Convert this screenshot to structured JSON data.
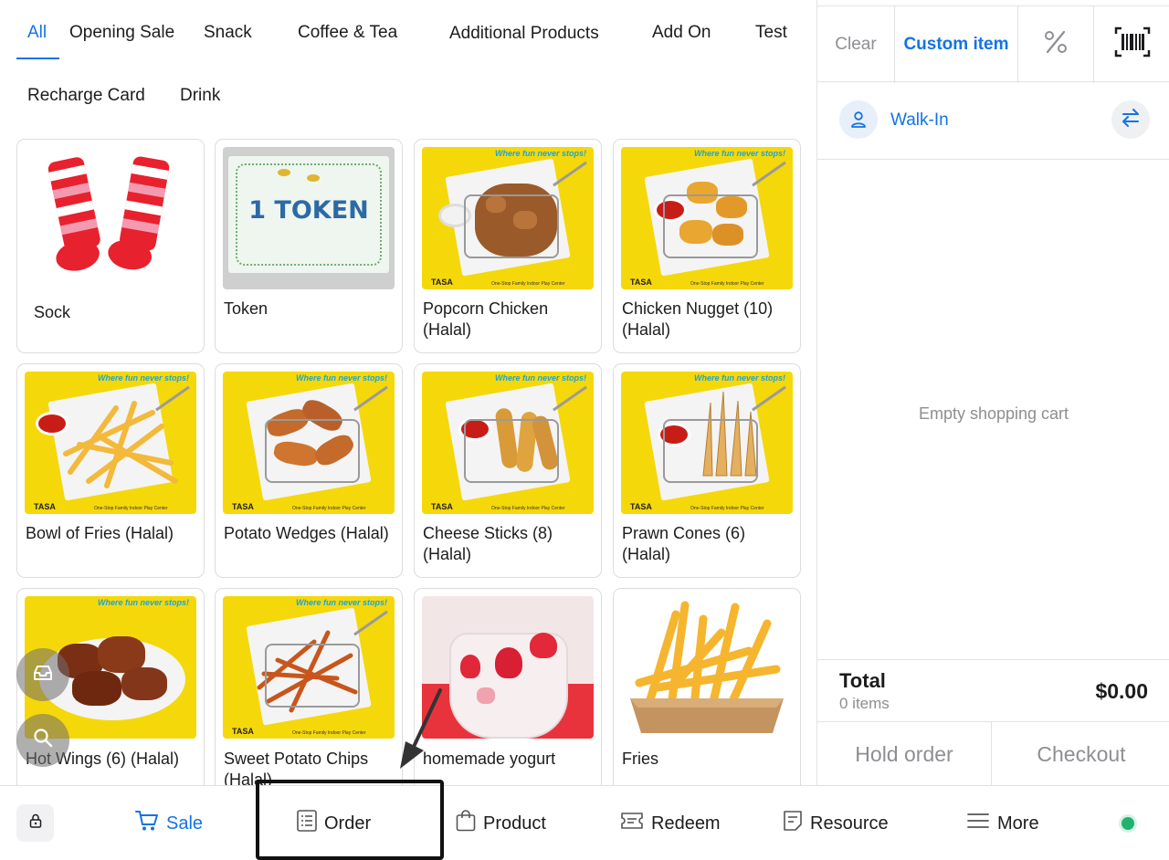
{
  "tabs": [
    {
      "label": "All",
      "active": true
    },
    {
      "label": "Opening Sale"
    },
    {
      "label": "Snack"
    },
    {
      "label": "Coffee & Tea"
    },
    {
      "label": "Additional Products"
    },
    {
      "label": "Add On"
    },
    {
      "label": "Test"
    },
    {
      "label": "Recharge Card"
    },
    {
      "label": "Drink"
    }
  ],
  "products": [
    {
      "name": "Sock",
      "image": "sock"
    },
    {
      "name": "Token",
      "image": "token",
      "image_text": "1 TOKEN"
    },
    {
      "name": "Popcorn Chicken (Halal)",
      "image": "popcorn-chicken"
    },
    {
      "name": "Chicken Nugget (10) (Halal)",
      "image": "chicken-nugget"
    },
    {
      "name": "Bowl of Fries (Halal)",
      "image": "fries-basket"
    },
    {
      "name": "Potato Wedges (Halal)",
      "image": "potato-wedges"
    },
    {
      "name": "Cheese Sticks (8) (Halal)",
      "image": "cheese-sticks"
    },
    {
      "name": "Prawn Cones (6) (Halal)",
      "image": "prawn-cones"
    },
    {
      "name": "Hot Wings (6) (Halal)",
      "image": "hot-wings"
    },
    {
      "name": "Sweet Potato Chips (Halal)",
      "image": "sweet-potato-chips"
    },
    {
      "name": "homemade yogurt",
      "image": "yogurt"
    },
    {
      "name": "Fries",
      "image": "fries-box"
    }
  ],
  "food_image_text": {
    "slogan": "Where fun never stops!",
    "brand": "TASA",
    "fine_print": "One-Stop Family Indoor Play Center"
  },
  "cart": {
    "clear_label": "Clear",
    "custom_item_label": "Custom item",
    "customer": "Walk-In",
    "empty_text": "Empty shopping cart",
    "total_label": "Total",
    "items_count": "0 items",
    "total_value": "$0.00",
    "hold_label": "Hold order",
    "checkout_label": "Checkout"
  },
  "nav": {
    "sale": "Sale",
    "order": "Order",
    "product": "Product",
    "redeem": "Redeem",
    "resource": "Resource",
    "more": "More"
  },
  "colors": {
    "accent": "#1473e6",
    "food_bg": "#f5d80a",
    "status_online": "#23b26d"
  }
}
